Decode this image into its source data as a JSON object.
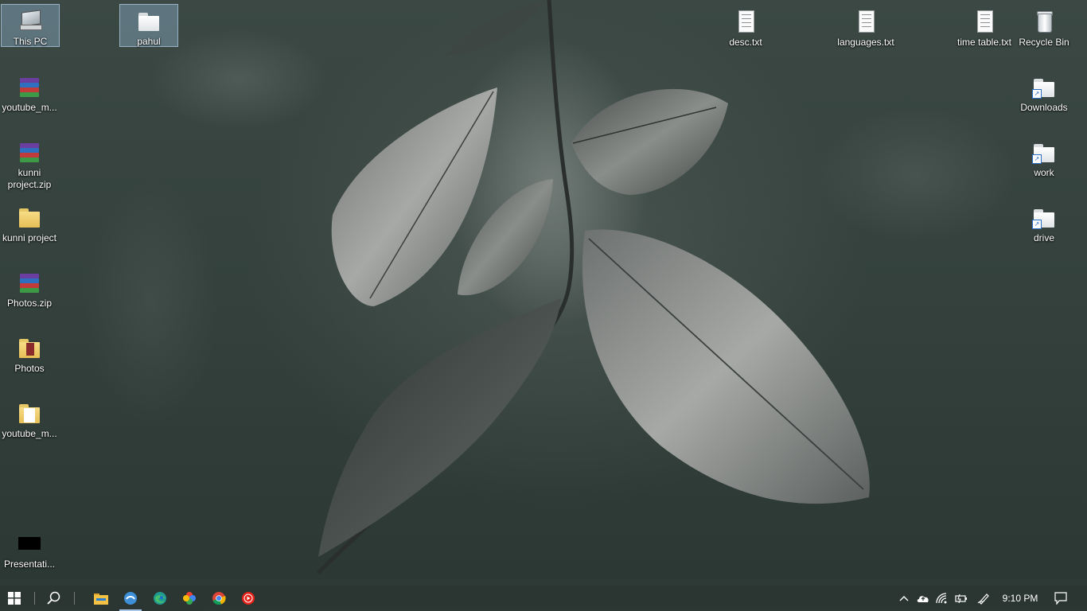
{
  "desktop": {
    "icons_left": [
      {
        "label": "This PC",
        "icon": "this-pc-icon",
        "selected": true
      },
      {
        "label": "youtube_m...",
        "icon": "winrar-archive-icon"
      },
      {
        "label": "kunni project.zip",
        "icon": "winrar-archive-icon"
      },
      {
        "label": "kunni project",
        "icon": "folder-icon"
      },
      {
        "label": "Photos.zip",
        "icon": "winrar-archive-icon"
      },
      {
        "label": "Photos",
        "icon": "folder-icon"
      },
      {
        "label": "youtube_m...",
        "icon": "folder-icon"
      },
      {
        "label": "Presentati...",
        "icon": "black-thumbnail-icon"
      }
    ],
    "pahul": {
      "label": "pahul",
      "icon": "folder-icon",
      "selected": true
    },
    "icons_top": [
      {
        "label": "desc.txt",
        "icon": "text-file-icon"
      },
      {
        "label": "languages.txt",
        "icon": "text-file-icon"
      },
      {
        "label": "time table.txt",
        "icon": "text-file-icon"
      }
    ],
    "icons_right": [
      {
        "label": "Recycle Bin",
        "icon": "recycle-bin-icon"
      },
      {
        "label": "Downloads",
        "icon": "folder-shortcut-icon"
      },
      {
        "label": "work",
        "icon": "folder-shortcut-icon"
      },
      {
        "label": "drive",
        "icon": "folder-shortcut-icon"
      }
    ]
  },
  "taskbar": {
    "start": "windows-start-icon",
    "search": "search-icon",
    "pinned": [
      {
        "name": "file-explorer-icon"
      },
      {
        "name": "app-icon",
        "active": true
      },
      {
        "name": "edge-icon"
      },
      {
        "name": "photos-icon"
      },
      {
        "name": "chrome-icon"
      },
      {
        "name": "youtube-music-icon"
      }
    ],
    "tray": {
      "icons": [
        "show-hidden-icons-chevron-icon",
        "onedrive-cloud-icon",
        "network-icon",
        "battery-icon",
        "pen-icon"
      ],
      "clock": "9:10 PM",
      "notification": "action-center-icon"
    }
  },
  "colors": {
    "selection": "#a0c8eb",
    "taskbar": "#2c3633",
    "accent": "#a8c7ea"
  }
}
